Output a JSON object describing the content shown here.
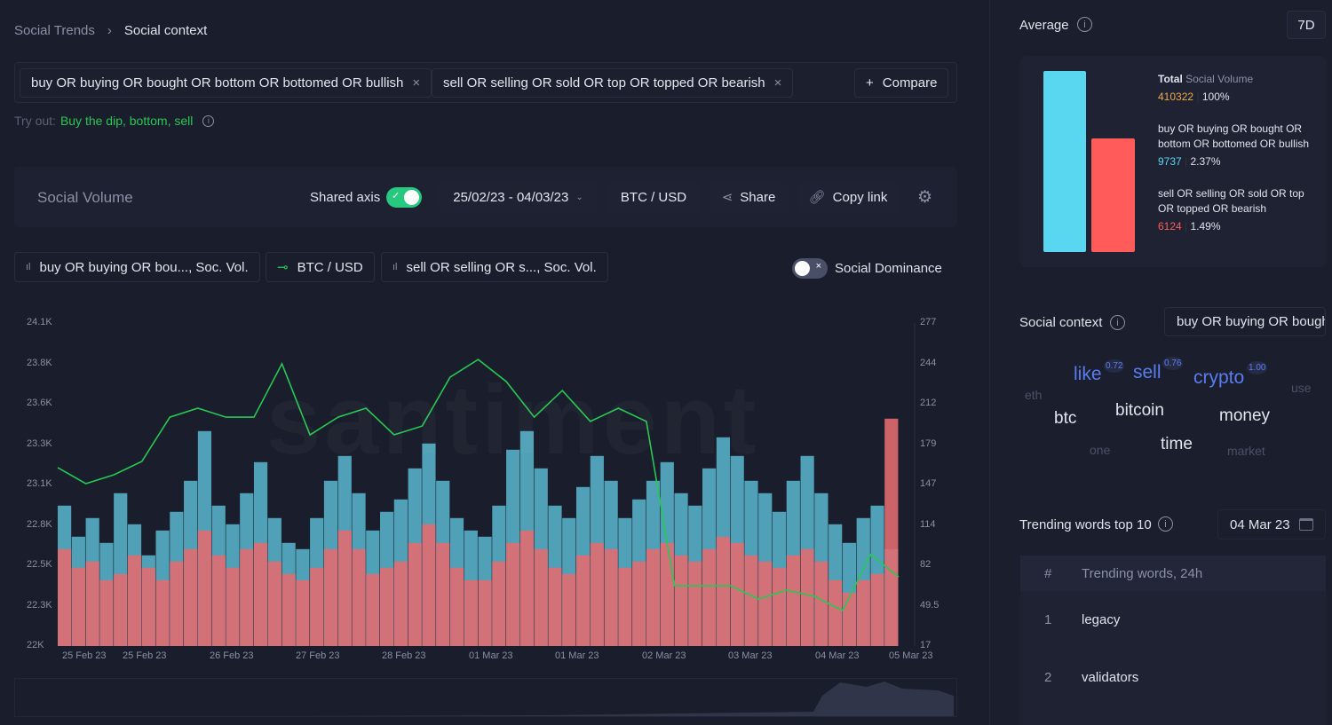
{
  "breadcrumb": {
    "parent": "Social Trends",
    "current": "Social context"
  },
  "search": {
    "queries": [
      "buy OR buying OR bought OR bottom OR bottomed OR bullish",
      "sell OR selling OR sold OR top OR topped OR bearish"
    ],
    "compare_label": "Compare"
  },
  "try_out": {
    "label": "Try out:",
    "links": "Buy the dip, bottom, sell"
  },
  "chart_header": {
    "title": "Social Volume",
    "shared_axis": "Shared axis",
    "shared_axis_on": true,
    "date_range": "25/02/23 - 04/03/23",
    "pair": "BTC / USD",
    "share": "Share",
    "copy_link": "Copy link"
  },
  "legend": {
    "items": [
      "buy OR buying OR bou..., Soc. Vol.",
      "BTC / USD",
      "sell OR selling OR s..., Soc. Vol."
    ],
    "social_dominance": "Social Dominance",
    "social_dominance_on": false
  },
  "watermark": "santiment",
  "chart_data": {
    "type": "bar+line",
    "left_axis": {
      "ticks": [
        "24.1K",
        "23.8K",
        "23.6K",
        "23.3K",
        "23.1K",
        "22.8K",
        "22.5K",
        "22.3K",
        "22K"
      ],
      "range": [
        22000,
        24100
      ]
    },
    "right_axis": {
      "ticks": [
        "277",
        "244",
        "212",
        "179",
        "147",
        "114",
        "82",
        "49.5",
        "17"
      ],
      "range": [
        17,
        277
      ]
    },
    "x_ticks": [
      "25 Feb 23",
      "25 Feb 23",
      "26 Feb 23",
      "27 Feb 23",
      "28 Feb 23",
      "01 Mar 23",
      "01 Mar 23",
      "02 Mar 23",
      "03 Mar 23",
      "04 Mar 23",
      "05 Mar 23"
    ],
    "colors": {
      "buy": "#5bb8d0",
      "sell": "#e06b70",
      "btc": "#26c953"
    },
    "btc_price": [
      23160,
      23056,
      23113,
      23200,
      23488,
      23546,
      23488,
      23488,
      23835,
      23373,
      23488,
      23546,
      23373,
      23430,
      23748,
      23863,
      23719,
      23488,
      23661,
      23460,
      23546,
      23460,
      22392,
      22392,
      22392,
      22306,
      22363,
      22323,
      22230,
      22594,
      22450
    ],
    "buy_volume": [
      130,
      105,
      120,
      100,
      140,
      115,
      90,
      110,
      125,
      150,
      190,
      130,
      115,
      140,
      165,
      120,
      100,
      95,
      120,
      150,
      170,
      140,
      110,
      125,
      135,
      160,
      180,
      150,
      120,
      110,
      105,
      130,
      175,
      190,
      160,
      130,
      120,
      145,
      170,
      150,
      120,
      135,
      150,
      165,
      140,
      130,
      160,
      185,
      170,
      150,
      140,
      125,
      150,
      170,
      140,
      115,
      100,
      120,
      130,
      95
    ],
    "sell_volume": [
      95,
      80,
      85,
      70,
      75,
      90,
      80,
      70,
      85,
      95,
      110,
      90,
      80,
      95,
      100,
      85,
      75,
      70,
      80,
      95,
      110,
      95,
      75,
      80,
      85,
      100,
      115,
      100,
      80,
      70,
      70,
      85,
      100,
      110,
      95,
      80,
      75,
      90,
      100,
      95,
      80,
      85,
      95,
      100,
      90,
      85,
      95,
      105,
      100,
      90,
      85,
      80,
      90,
      95,
      85,
      70,
      60,
      70,
      75,
      200
    ]
  },
  "sidebar": {
    "average_label": "Average",
    "period": "7D",
    "total": {
      "label_bold": "Total",
      "label": "Social Volume",
      "value": "410322",
      "pct": "100%"
    },
    "series": [
      {
        "label": "buy OR buying OR bought OR bottom OR bottomed OR bullish",
        "value": "9737",
        "pct": "2.37%",
        "color": "#5ad7f0"
      },
      {
        "label": "sell OR selling OR sold OR top OR topped OR bearish",
        "value": "6124",
        "pct": "1.49%",
        "color": "#ff5b5b"
      }
    ],
    "social_context": {
      "title": "Social context",
      "selector": "buy OR buying OR bought",
      "words": [
        {
          "w": "like",
          "score": "0.72"
        },
        {
          "w": "sell",
          "score": "0.76"
        },
        {
          "w": "crypto",
          "score": "1.00"
        },
        {
          "w": "eth"
        },
        {
          "w": "use"
        },
        {
          "w": "btc"
        },
        {
          "w": "bitcoin"
        },
        {
          "w": "money"
        },
        {
          "w": "time"
        },
        {
          "w": "one"
        },
        {
          "w": "market"
        }
      ]
    },
    "trending": {
      "title": "Trending words top 10",
      "date": "04 Mar 23",
      "col_num": "#",
      "col_words": "Trending words, 24h",
      "rows": [
        {
          "n": "1",
          "word": "legacy"
        },
        {
          "n": "2",
          "word": "validators"
        }
      ]
    }
  }
}
